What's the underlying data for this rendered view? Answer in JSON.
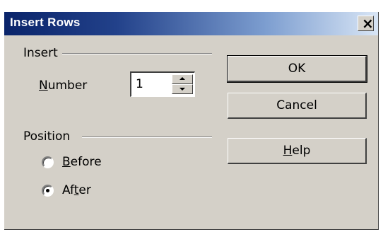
{
  "dialog": {
    "title": "Insert Rows",
    "close_glyph": "×"
  },
  "insert_group": {
    "label": "Insert",
    "number_label_pre": "",
    "number_label_accel": "N",
    "number_label_post": "umber",
    "number_value": "1"
  },
  "position_group": {
    "label": "Position",
    "options": [
      {
        "pre": "",
        "accel": "B",
        "post": "efore",
        "checked": false
      },
      {
        "pre": "Af",
        "accel": "t",
        "post": "er",
        "checked": true
      }
    ]
  },
  "buttons": {
    "ok": "OK",
    "cancel": "Cancel",
    "help_accel": "H",
    "help_post": "elp"
  },
  "icons": [
    "close-icon",
    "spin-up-icon",
    "spin-down-icon"
  ]
}
